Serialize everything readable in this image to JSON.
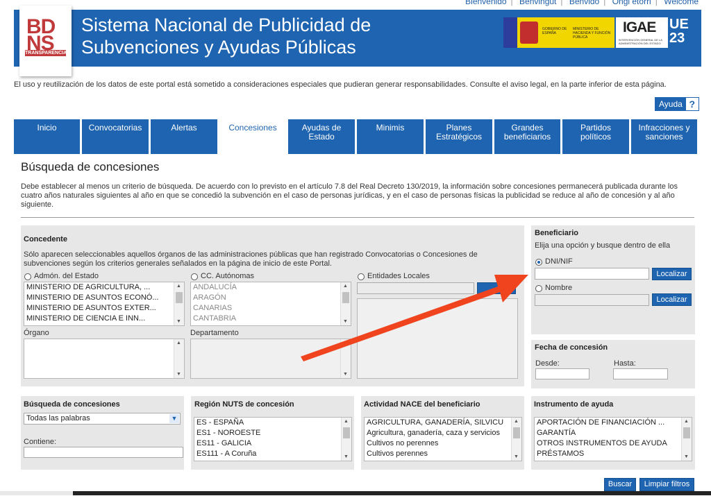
{
  "top_links": [
    "Bienvenido",
    "Benvingut",
    "Benvido",
    "Ongi etorri",
    "Welcome"
  ],
  "logo": {
    "line1": "BD",
    "line2": "NS",
    "line3": "TRANSPARENCIA"
  },
  "header": {
    "title_line1": "Sistema Nacional de Publicidad de",
    "title_line2": "Subvenciones y Ayudas Públicas",
    "gov_text1": "GOBIERNO DE ESPAÑA",
    "gov_text2": "MINISTERIO DE HACIENDA Y FUNCIÓN PÚBLICA",
    "igae_big": "IGAE",
    "igae_small": "INTERVENCIÓN GENERAL DE LA ADMINISTRACIÓN DEL ESTADO",
    "u23_1": "UE",
    "u23_2": "23"
  },
  "notice": "El uso y reutilización de los datos de este portal está sometido a consideraciones especiales que pudieran generar responsabilidades. Consulte el aviso legal, en la parte inferior de esta página.",
  "help": {
    "label": "Ayuda",
    "icon": "?"
  },
  "tabs": [
    {
      "label": "Inicio"
    },
    {
      "label": "Convocatorias"
    },
    {
      "label": "Alertas"
    },
    {
      "label": "Concesiones",
      "active": true
    },
    {
      "label": "Ayudas de Estado"
    },
    {
      "label": "Minimis"
    },
    {
      "label": "Planes Estratégicos"
    },
    {
      "label": "Grandes beneficiarios"
    },
    {
      "label": "Partidos políticos"
    },
    {
      "label": "Infracciones y sanciones"
    }
  ],
  "page": {
    "title": "Búsqueda de concesiones",
    "intro": "Debe establecer al menos un criterio de búsqueda. De acuerdo con lo previsto en el artículo 7.8 del Real Decreto 130/2019, la información sobre concesiones permanecerá publicada durante los cuatro años naturales siguientes al año en que se concedió la subvención en el caso de personas jurídicas, y en el caso de personas físicas la publicidad se reduce al año de concesión y al año siguiente."
  },
  "concedente": {
    "title": "Concedente",
    "text": "Sólo aparecen seleccionables aquellos órganos de las administraciones públicas que han registrado Convocatorias o Concesiones de subvenciones según los criterios generales señalados en la página de inicio de este Portal.",
    "estado_label": "Admón. del Estado",
    "estado_options": [
      "MINISTERIO DE AGRICULTURA, ...",
      "MINISTERIO DE ASUNTOS ECONÓ...",
      "MINISTERIO DE ASUNTOS EXTER...",
      "MINISTERIO DE CIENCIA E INN..."
    ],
    "ccaa_label": "CC. Autónomas",
    "ccaa_options": [
      "ANDALUCÍA",
      "ARAGÓN",
      "CANARIAS",
      "CANTABRIA"
    ],
    "locales_label": "Entidades Locales",
    "organo_label": "Órgano",
    "departamento_label": "Departamento"
  },
  "beneficiario": {
    "title": "Beneficiario",
    "subtitle": "Elija una opción y busque dentro de ella",
    "dni_label": "DNI/NIF",
    "nombre_label": "Nombre",
    "localizar": "Localizar"
  },
  "fecha": {
    "title": "Fecha de concesión",
    "desde": "Desde:",
    "hasta": "Hasta:"
  },
  "busqueda": {
    "title": "Búsqueda de concesiones",
    "mode_selected": "Todas las palabras",
    "contiene_label": "Contiene:"
  },
  "nuts": {
    "title": "Región NUTS de concesión",
    "options": [
      "ES - ESPAÑA",
      "ES1 - NOROESTE",
      "ES11 - GALICIA",
      "ES111 - A Coruña"
    ]
  },
  "nace": {
    "title": "Actividad NACE del beneficiario",
    "options": [
      "AGRICULTURA, GANADERÍA, SILVICU",
      "Agricultura, ganadería, caza y servicios",
      "Cultivos no perennes",
      "Cultivos perennes"
    ]
  },
  "instrumento": {
    "title": "Instrumento de ayuda",
    "options": [
      "APORTACIÓN DE FINANCIACIÓN ...",
      "GARANTÍA",
      "OTROS INSTRUMENTOS DE AYUDA",
      "PRÉSTAMOS"
    ]
  },
  "actions": {
    "buscar": "Buscar",
    "limpiar": "Limpiar filtros"
  },
  "colors": {
    "brand": "#1f64b0",
    "logo_red": "#c0393b",
    "arrow": "#f0441f",
    "panel_bg": "#e7e7e7"
  }
}
